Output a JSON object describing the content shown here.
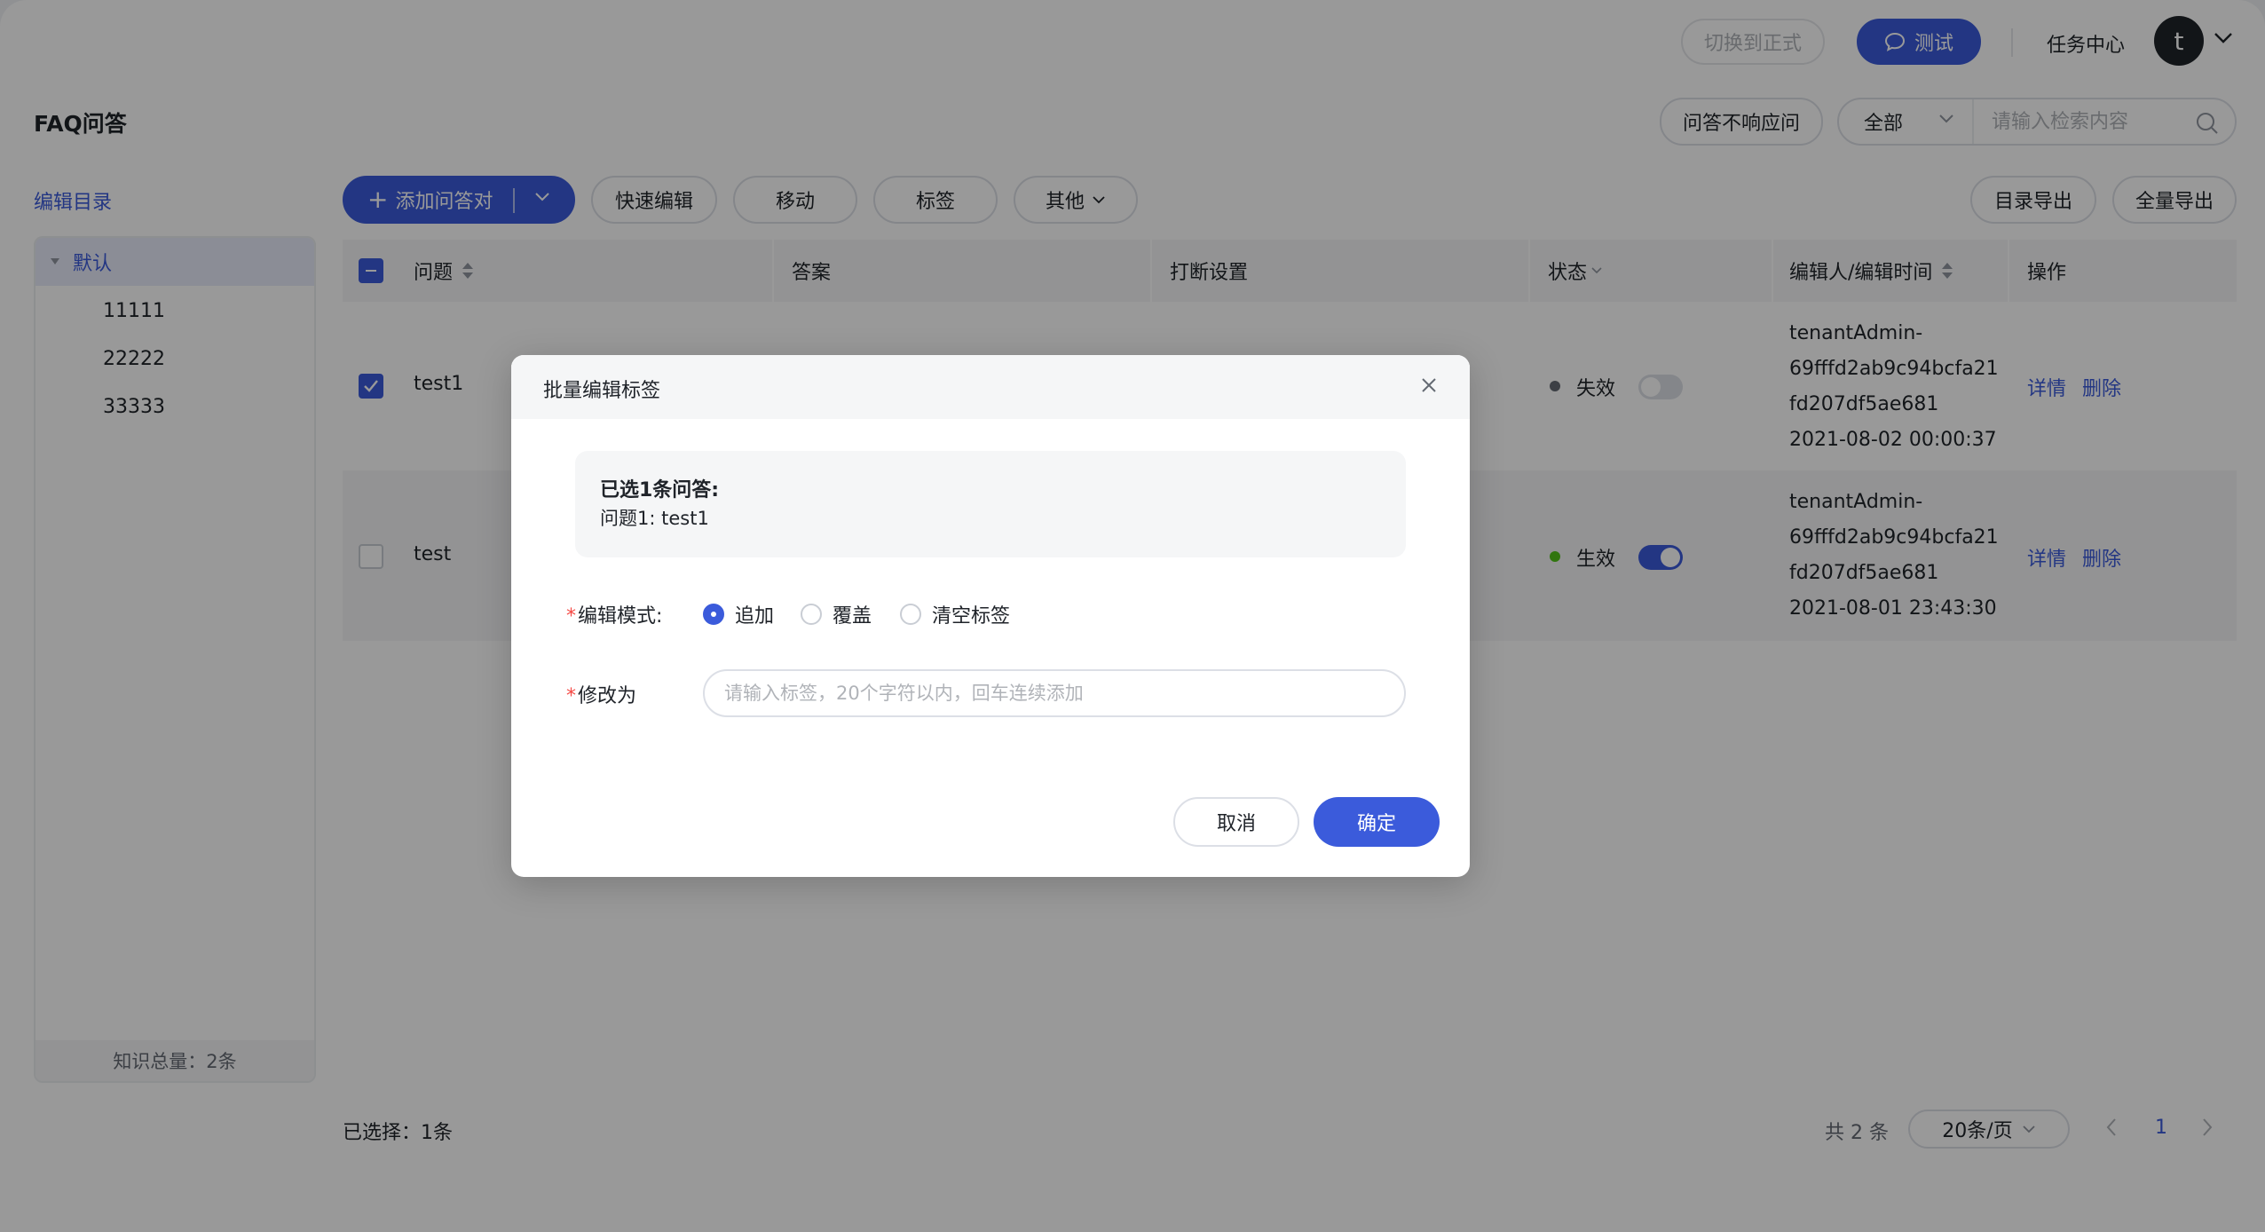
{
  "header": {
    "switch_label": "切换到正式",
    "test_label": "测试",
    "task_center": "任务中心",
    "avatar_letter": "t"
  },
  "page": {
    "title": "FAQ问答",
    "no_response_label": "问答不响应问",
    "filter_value": "全部",
    "search_placeholder": "请输入检索内容"
  },
  "sidebar": {
    "title": "编辑目录",
    "root": "默认",
    "items": [
      {
        "label": "11111"
      },
      {
        "label": "22222"
      },
      {
        "label": "33333"
      }
    ],
    "footer": "知识总量：2条"
  },
  "toolbar": {
    "add_label": "添加问答对",
    "quick_edit": "快速编辑",
    "move": "移动",
    "tag": "标签",
    "other": "其他",
    "export_dir": "目录导出",
    "export_all": "全量导出"
  },
  "table": {
    "columns": {
      "question": "问题",
      "answer": "答案",
      "interrupt": "打断设置",
      "status": "状态",
      "editor": "编辑人/编辑时间",
      "ops": "操作"
    },
    "rows": [
      {
        "question": "test1",
        "checked": true,
        "status": "失效",
        "enabled": false,
        "editor_lines": [
          "tenantAdmin-",
          "69fffd2ab9c94bcfa21",
          "fd207df5ae681",
          "2021-08-02 00:00:37"
        ],
        "detail": "详情",
        "delete": "删除"
      },
      {
        "question": "test",
        "checked": false,
        "status": "生效",
        "enabled": true,
        "editor_lines": [
          "tenantAdmin-",
          "69fffd2ab9c94bcfa21",
          "fd207df5ae681",
          "2021-08-01 23:43:30"
        ],
        "detail": "详情",
        "delete": "删除"
      }
    ]
  },
  "footer": {
    "selected": "已选择：1条",
    "total": "共 2 条",
    "page_size": "20条/页",
    "current_page": "1"
  },
  "modal": {
    "title": "批量编辑标签",
    "selected_title": "已选1条问答:",
    "selected_item": "问题1:  test1",
    "mode_label": "编辑模式:",
    "modes": [
      {
        "label": "追加",
        "selected": true
      },
      {
        "label": "覆盖",
        "selected": false
      },
      {
        "label": "清空标签",
        "selected": false
      }
    ],
    "change_label": "修改为",
    "input_placeholder": "请输入标签，20个字符以内，回车连续添加",
    "cancel": "取消",
    "ok": "确定"
  },
  "colors": {
    "primary": "#3b5bdb",
    "status_off": "#646a73",
    "status_on": "#52c41a",
    "required": "#f54a45"
  }
}
